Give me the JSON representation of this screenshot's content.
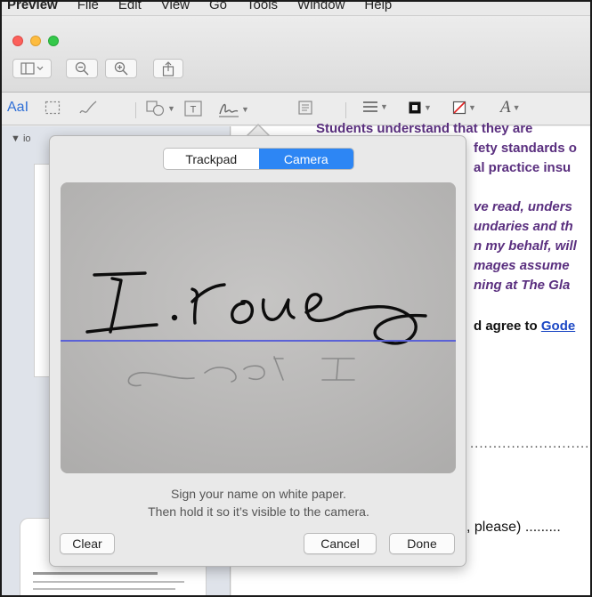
{
  "menubar": {
    "app": "Preview",
    "items": [
      "File",
      "Edit",
      "View",
      "Go",
      "Tools",
      "Window",
      "Help"
    ]
  },
  "markup_toolbar": {
    "text_style_label": "AaI"
  },
  "sidebar": {
    "heading": "io"
  },
  "document": {
    "lines": [
      "Students understand that they are",
      "fety standards o",
      "al practice insu",
      "ve read, unders",
      "undaries and th",
      "n my behalf, will",
      "mages assume",
      "ning at The Gla",
      "d agree to",
      "Gode"
    ],
    "dotted_line": "..................................",
    "please_line": ", please) ........."
  },
  "signature_popover": {
    "tabs": [
      {
        "label": "Trackpad",
        "active": false
      },
      {
        "label": "Camera",
        "active": true
      }
    ],
    "hint_line1": "Sign your name on white paper.",
    "hint_line2": "Then hold it so it’s visible to the camera.",
    "clear_label": "Clear",
    "cancel_label": "Cancel",
    "done_label": "Done",
    "baseline_color": "#5b62d6"
  },
  "colors": {
    "accent": "#2d86f4",
    "document_purple": "#5a2f7f",
    "link_blue": "#1b47c4"
  }
}
